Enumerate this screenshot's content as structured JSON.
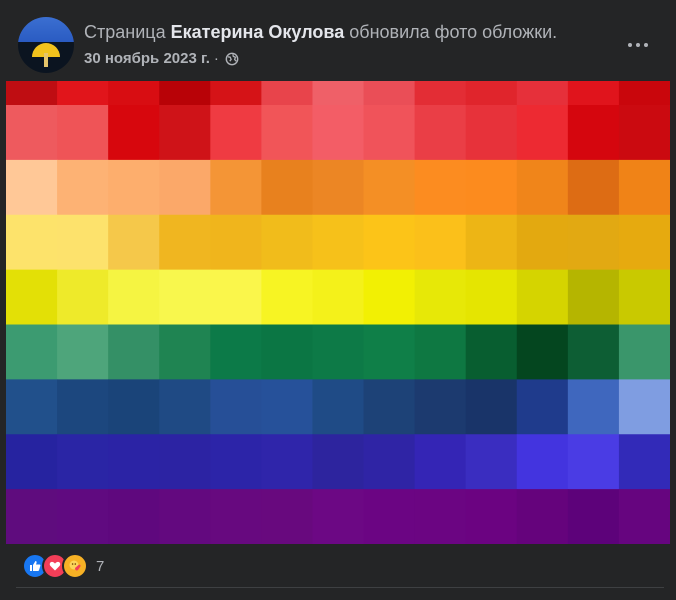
{
  "post": {
    "prefix": "Страница",
    "author": "Екатерина Окулова",
    "action": "обновила фото обложки.",
    "date": "30 ноябрь 2023 г.",
    "separator": "·",
    "privacy_icon": "globe-icon",
    "more_icon": "more-horizontal-icon"
  },
  "reactions": {
    "icons": [
      "like-icon",
      "love-icon",
      "care-icon"
    ],
    "count": "7"
  },
  "cover": {
    "description_icon": "pixelated-rainbow-flag",
    "rows": [
      [
        "#bf0d12",
        "#e1151b",
        "#d80d12",
        "#b80207",
        "#d51317",
        "#e8444b",
        "#ef6068",
        "#ea4e57",
        "#e32d35",
        "#e0252c",
        "#e6303a",
        "#e0141c",
        "#c9060c"
      ],
      [
        "#ee5a5e",
        "#ef5457",
        "#d7070d",
        "#cf1318",
        "#ef3b42",
        "#f15558",
        "#f35d66",
        "#f0535a",
        "#ea3e46",
        "#e7323a",
        "#ed2a32",
        "#d5060e",
        "#cb0a10"
      ],
      [
        "#ffc897",
        "#fdb274",
        "#fdae6d",
        "#fba869",
        "#f49536",
        "#e8811e",
        "#ec8624",
        "#f48f25",
        "#fc8c20",
        "#fc8b1e",
        "#f0851a",
        "#dd6c14",
        "#f08317"
      ],
      [
        "#fde36b",
        "#fde26c",
        "#f5c84a",
        "#f0b620",
        "#f0b51c",
        "#f1bc1b",
        "#f6c11a",
        "#fcc418",
        "#fbc01a",
        "#edb515",
        "#e3a910",
        "#e2a912",
        "#e6aa0f"
      ],
      [
        "#e3e006",
        "#eeea2a",
        "#f5f442",
        "#f8f74d",
        "#faf64b",
        "#f7f423",
        "#f4f11a",
        "#f2f003",
        "#e7e807",
        "#e5e501",
        "#d5d400",
        "#b5b500",
        "#c9c900"
      ],
      [
        "#3c9b71",
        "#4ea57b",
        "#349066",
        "#1f8452",
        "#0c7a48",
        "#0b7644",
        "#0d7a47",
        "#0f7f48",
        "#0e7842",
        "#085e30",
        "#04461f",
        "#0d5e34",
        "#3a966b"
      ],
      [
        "#21508b",
        "#1c477e",
        "#1a4479",
        "#1f4a84",
        "#264f97",
        "#26519a",
        "#1f4b86",
        "#1d4277",
        "#1c3a6f",
        "#193469",
        "#1f3b8c",
        "#3f67be",
        "#7f9de1"
      ],
      [
        "#2623a0",
        "#2a25a5",
        "#2b23a5",
        "#2c23a3",
        "#2c24a8",
        "#2f25aa",
        "#2d249e",
        "#2f24a5",
        "#3425b5",
        "#3a2dc0",
        "#4334df",
        "#4a3ce4",
        "#322ab8"
      ],
      [
        "#5f0c7e",
        "#600a80",
        "#5f087e",
        "#63097f",
        "#67097f",
        "#68097e",
        "#6c0884",
        "#6b0583",
        "#6b0582",
        "#6b0381",
        "#65037c",
        "#5d027a",
        "#66057f"
      ]
    ]
  }
}
